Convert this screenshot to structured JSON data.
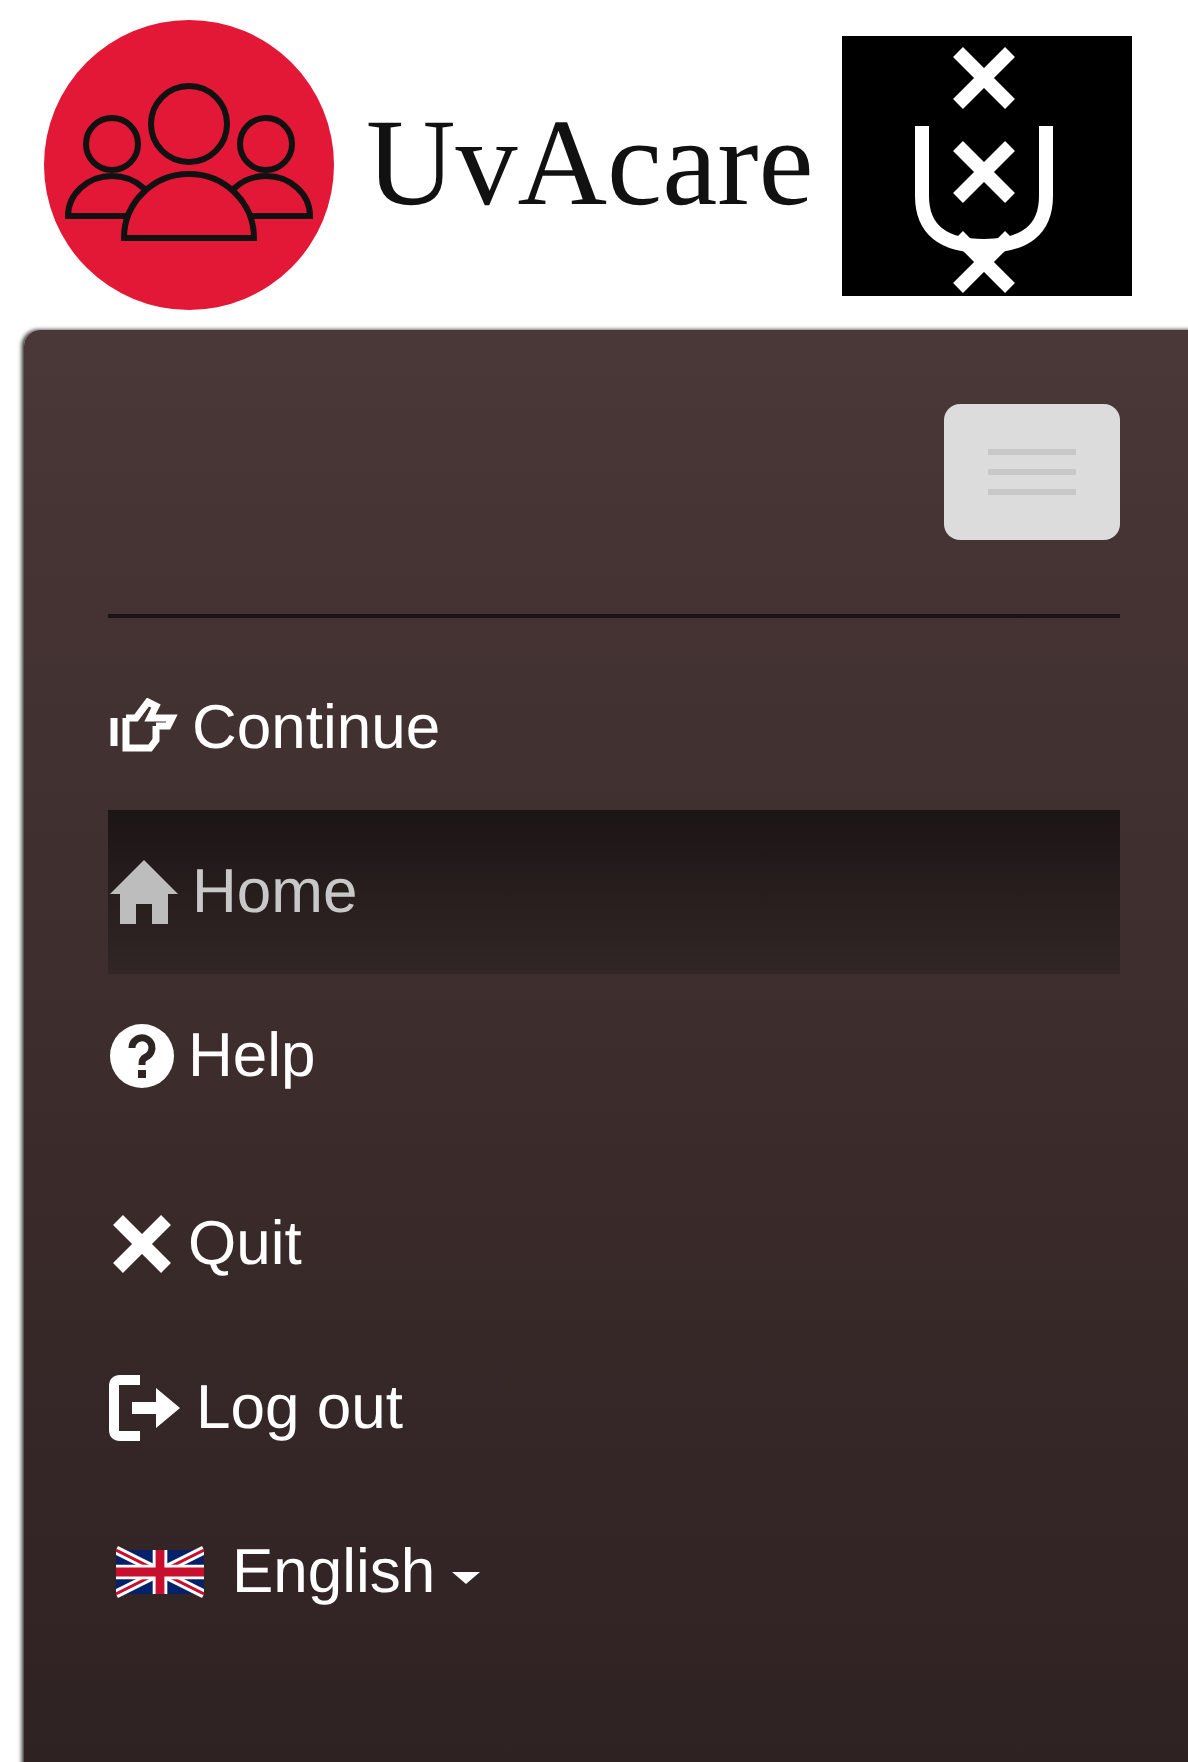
{
  "brand": {
    "name": "UvAcare"
  },
  "menu": [
    {
      "kind": "continue",
      "label": "Continue",
      "selected": false
    },
    {
      "kind": "home",
      "label": "Home",
      "selected": true
    },
    {
      "kind": "help",
      "label": "Help",
      "selected": false
    },
    {
      "kind": "quit",
      "label": "Quit",
      "selected": false
    },
    {
      "kind": "logout",
      "label": "Log out",
      "selected": false
    },
    {
      "kind": "language",
      "label": "English",
      "selected": false
    }
  ]
}
